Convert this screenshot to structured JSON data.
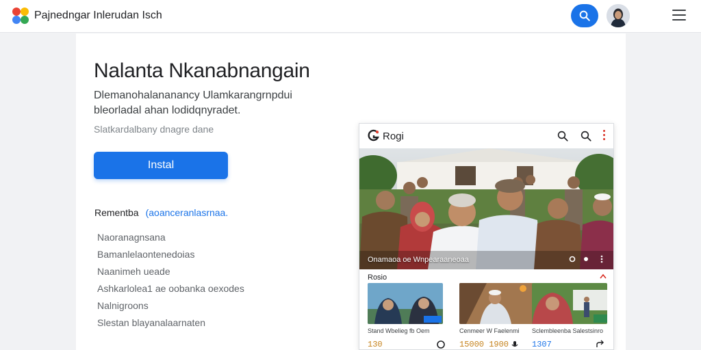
{
  "header": {
    "site_title": "Pajnedngar Inlerudan Isch",
    "logo_icon": "pinwheel-logo-icon",
    "search_icon": "search-icon",
    "menu_icon": "hamburger-menu-icon"
  },
  "app": {
    "name": "Nalanta Nkanabnangain",
    "description": "Dlemanohalananancy Ulamkarangrnpdui bleorladal ahan lodidqnyradet.",
    "meta": "Slatkardalbany dnagre dane",
    "install_label": "Instal"
  },
  "features": {
    "heading": "Rementba",
    "link": "(aoanceranlasrnaa.",
    "items": [
      "Naoranagnsana",
      "Bamanlelaontenedoias",
      "Naanimeh ueade",
      "Ashkarlolea1 ae oobanka oexodes",
      "Nalnigroons",
      "Slestan blayanalaarnaten"
    ]
  },
  "preview": {
    "app_title": "Rogi",
    "hero_caption": "Onamaoa oe Wnpearaaneoaa",
    "section_label": "Rosio",
    "thumbs": [
      {
        "caption": "Stand Wbelieg fb Oem",
        "count": "130"
      },
      {
        "caption": "Cenmeer W Faelenmi",
        "count": "15000 1900"
      },
      {
        "caption": "Sclembleenba Salestsinro",
        "count": "1307"
      }
    ]
  },
  "colors": {
    "accent": "#1a73e8",
    "title_text": "#202124",
    "muted_text": "#5f6368",
    "count_text": "#c5821b"
  }
}
